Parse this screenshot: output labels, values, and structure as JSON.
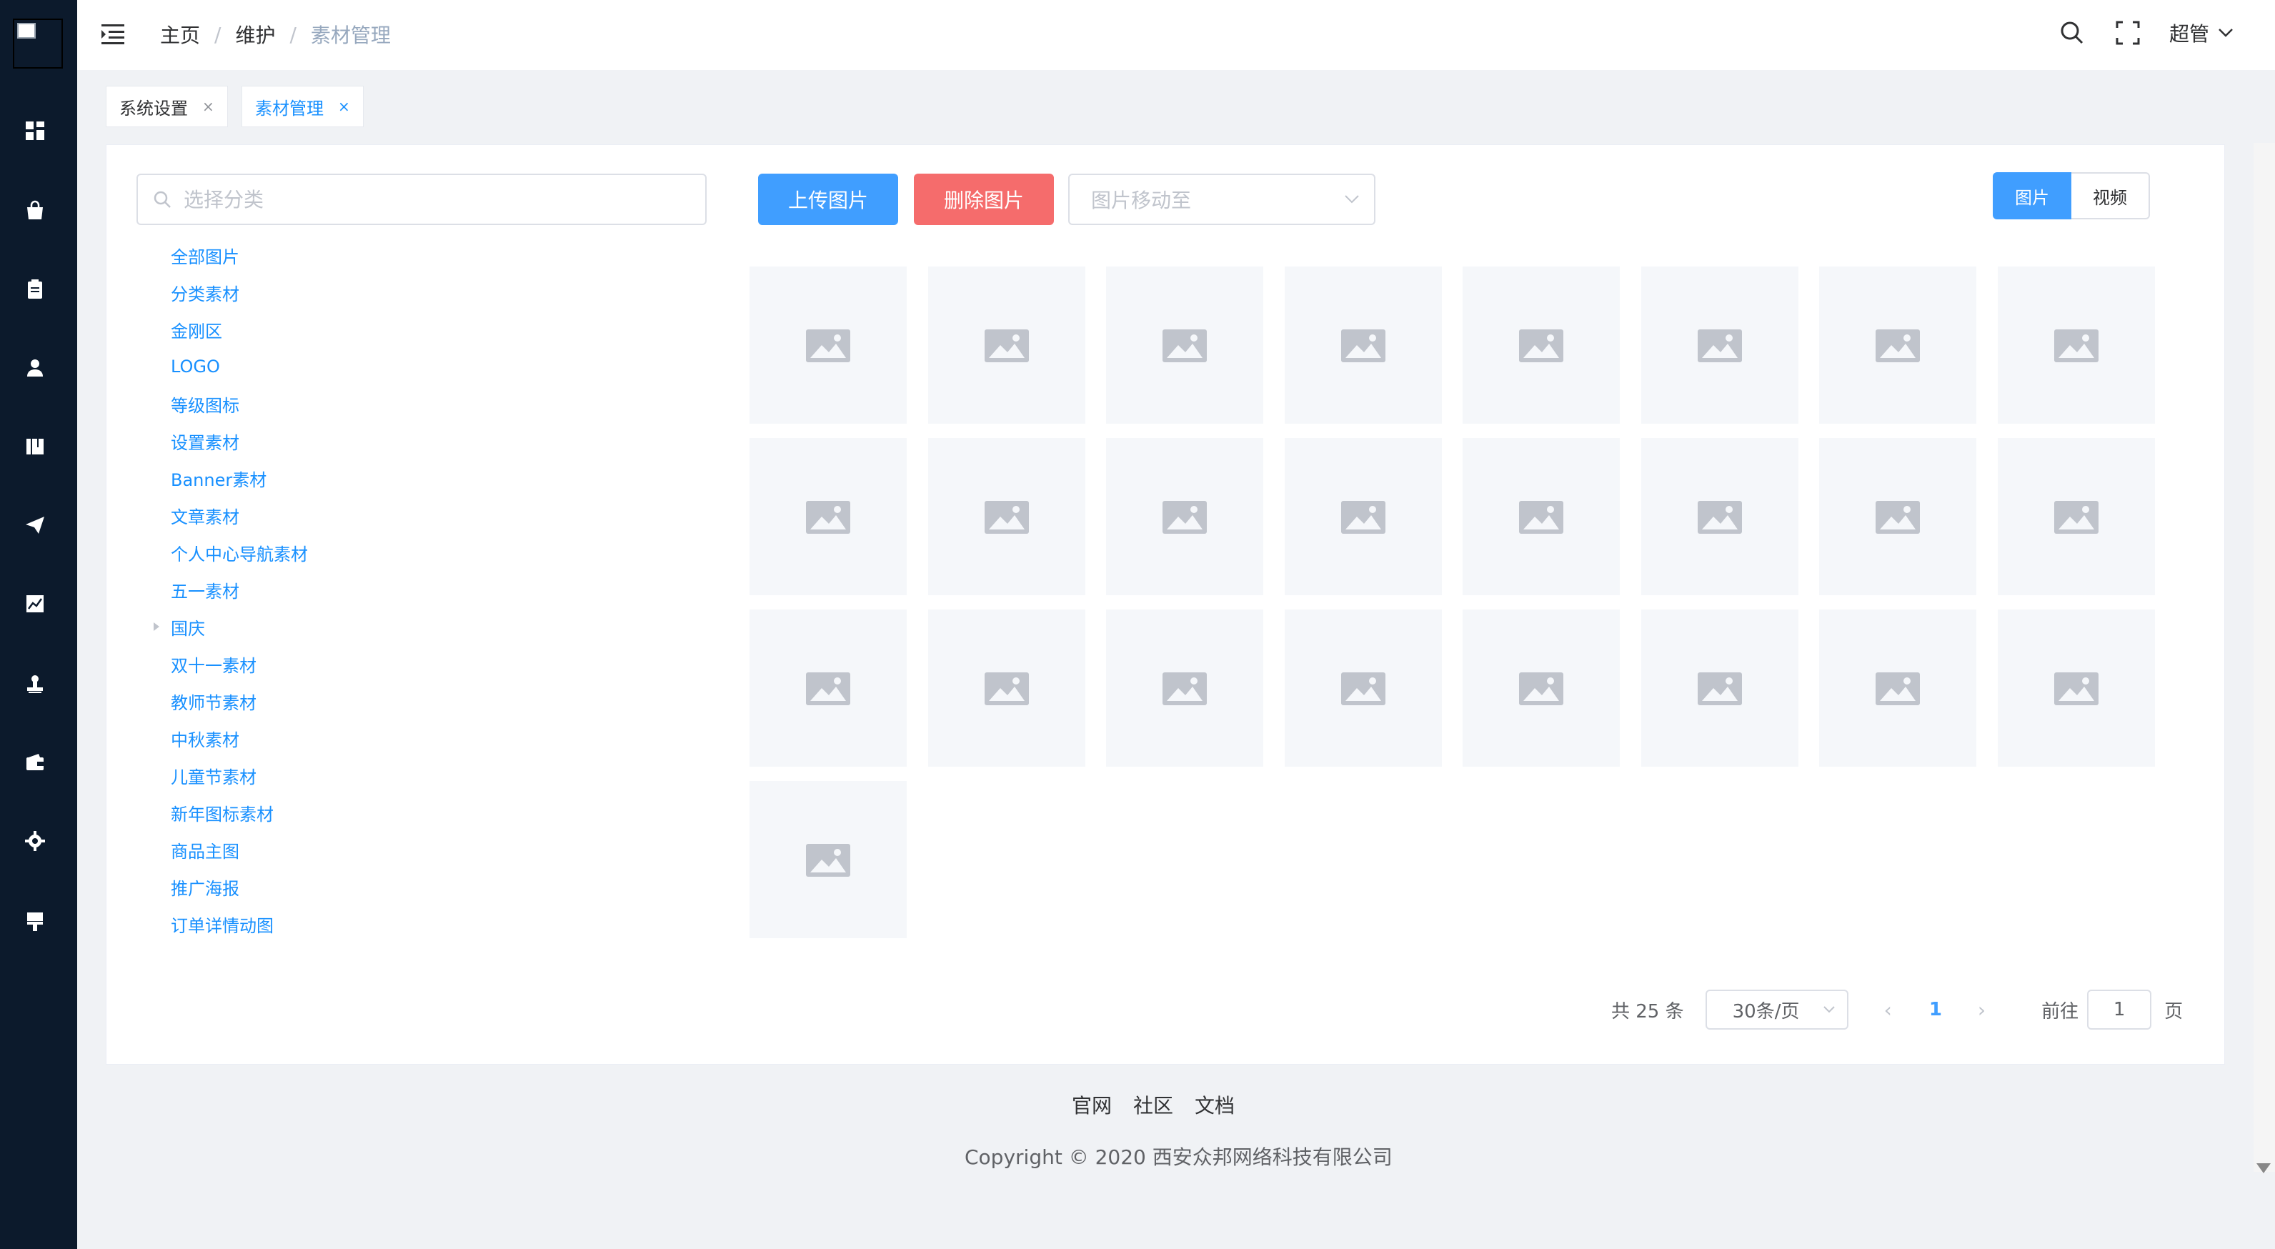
{
  "header": {
    "breadcrumb": [
      "主页",
      "维护",
      "素材管理"
    ],
    "user_name": "超管"
  },
  "tags": [
    {
      "label": "系统设置",
      "close": "×"
    },
    {
      "label": "素材管理",
      "close": "×"
    }
  ],
  "search": {
    "placeholder": "选择分类"
  },
  "categories": [
    "全部图片",
    "分类素材",
    "金刚区",
    "LOGO",
    "等级图标",
    "设置素材",
    "Banner素材",
    "文章素材",
    "个人中心导航素材",
    "五一素材",
    "国庆",
    "双十一素材",
    "教师节素材",
    "中秋素材",
    "儿童节素材",
    "新年图标素材",
    "商品主图",
    "推广海报",
    "订单详情动图"
  ],
  "toolbar": {
    "upload_label": "上传图片",
    "delete_label": "删除图片",
    "move_placeholder": "图片移动至",
    "tab_image": "图片",
    "tab_video": "视频"
  },
  "pagination": {
    "total": "共 25 条",
    "page_size": "30条/页",
    "current_page": "1",
    "goto_label": "前往",
    "goto_value": "1",
    "page_unit": "页"
  },
  "footer": {
    "links": [
      "官网",
      "社区",
      "文档"
    ],
    "copyright": "Copyright © 2020 西安众邦网络科技有限公司"
  },
  "images_count": 25,
  "colors": {
    "sidebar": "#0c1a2c",
    "primary": "#409eff",
    "danger": "#f56c6c"
  }
}
